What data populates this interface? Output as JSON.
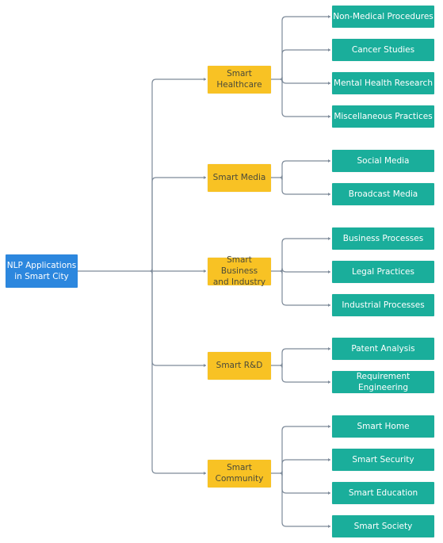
{
  "colors": {
    "root": "#2c87de",
    "category": "#f8c224",
    "leaf": "#1aae9b",
    "connector": "#7d8a99"
  },
  "root": {
    "label_line1": "NLP Applications",
    "label_line2": "in Smart City"
  },
  "categories": [
    {
      "label_line1": "Smart",
      "label_line2": "Healthcare",
      "children": [
        "Non-Medical Procedures",
        "Cancer Studies",
        "Mental Health Research",
        "Miscellaneous Practices"
      ]
    },
    {
      "label_line1": "Smart Media",
      "label_line2": "",
      "children": [
        "Social Media",
        "Broadcast Media"
      ]
    },
    {
      "label_line1": "Smart Business",
      "label_line2": "and Industry",
      "children": [
        "Business Processes",
        "Legal Practices",
        "Industrial Processes"
      ]
    },
    {
      "label_line1": "Smart R&D",
      "label_line2": "",
      "children": [
        "Patent Analysis",
        "Requirement Engineering"
      ]
    },
    {
      "label_line1": "Smart",
      "label_line2": "Community",
      "children": [
        "Smart Home",
        "Smart Security",
        "Smart Education",
        "Smart Society"
      ]
    }
  ]
}
